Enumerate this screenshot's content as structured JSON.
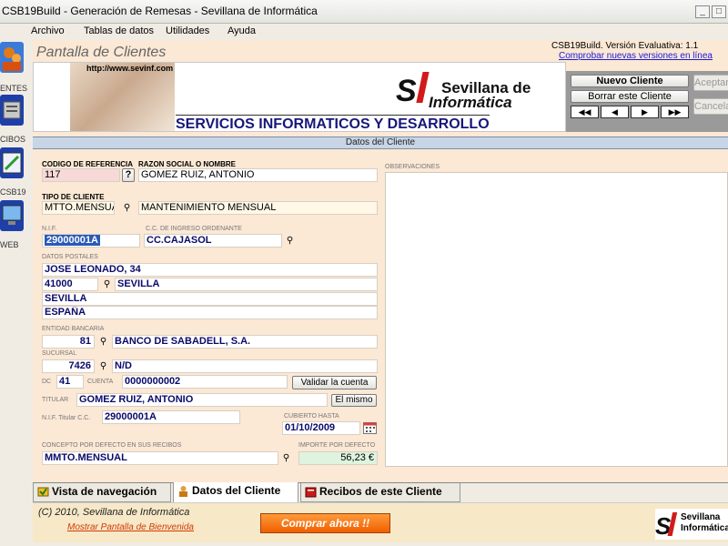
{
  "window": {
    "title": "CSB19Build - Generación de Remesas - Sevillana de Informática"
  },
  "menu": [
    "Archivo",
    "Tablas de datos",
    "Utilidades",
    "Ayuda"
  ],
  "left_toolbar": [
    {
      "label": "entes",
      "icon": "clients-icon"
    },
    {
      "label": "cibos",
      "icon": "receipts-icon"
    },
    {
      "label": "CSB19",
      "icon": "csb19-icon"
    },
    {
      "label": "Web",
      "icon": "web-icon"
    }
  ],
  "header": {
    "title": "Pantalla de Clientes",
    "version": "CSB19Build. Versión Evaluativa:  1.1",
    "check_updates": "Comprobar nuevas versiones en línea",
    "banner_url": "http://www.sevinf.com",
    "logo_line1": "Sevillana de",
    "logo_line2": "Informática",
    "services": "SERVICIOS INFORMATICOS Y DESARROLLO"
  },
  "buttons": {
    "new_client": "Nuevo Cliente",
    "delete_client": "Borrar este Cliente",
    "accept": "Aceptar",
    "cancel": "Cancelar",
    "nav_first": "◀◀",
    "nav_prev": "◀",
    "nav_next": "▶",
    "nav_last": "▶▶",
    "help": "?",
    "validate_account": "Validar la cuenta",
    "same": "El mismo"
  },
  "section_caption": "Datos del Cliente",
  "form": {
    "ref_label": "CODIGO DE REFERENCIA",
    "name_label": "RAZON SOCIAL O NOMBRE",
    "ref": "117",
    "name": "GOMEZ RUIZ, ANTONIO",
    "type_label": "TIPO DE CLIENTE",
    "type_code": "MTTO.MENSUAL",
    "type_desc": "MANTENIMIENTO MENSUAL",
    "nif_label": "N.I.F.",
    "nif": "29000001A",
    "cc_label": "C.C. DE INGRESO ORDENANTE",
    "cc": "CC.CAJASOL",
    "postal_label": "DATOS POSTALES",
    "address": "JOSE LEONADO, 34",
    "zip": "41000",
    "city": "SEVILLA",
    "province": "SEVILLA",
    "country": "ESPAÑA",
    "bank_label": "ENTIDAD BANCARIA",
    "bank_code": "81",
    "bank_name": "BANCO DE SABADELL, S.A.",
    "branch_label": "SUCURSAL",
    "branch_code": "7426",
    "branch_name": "N/D",
    "dc_label": "DC",
    "dc": "41",
    "account_label": "CUENTA",
    "account": "0000000002",
    "holder_label": "TITULAR",
    "holder": "GOMEZ RUIZ, ANTONIO",
    "holder_nif_label": "N.I.F. Titular C.C.",
    "holder_nif": "29000001A",
    "covered_label": "CUBIERTO HASTA",
    "covered_until": "01/10/2009",
    "concept_label": "CONCEPTO POR DEFECTO EN SUS RECIBOS",
    "concept": "MMTO.MENSUAL",
    "amount_label": "IMPORTE POR DEFECTO",
    "amount": "56,23 €",
    "obs_label": "OBSERVACIONES"
  },
  "tabs": [
    "Vista de navegación",
    "Datos del Cliente",
    "Recibos de este Cliente"
  ],
  "footer": {
    "copyright": "(C) 2010, Sevillana de Informática",
    "show_welcome": "Mostrar Pantalla de Bienvenida",
    "buy_now": "Comprar ahora !!",
    "logo_text": "Sevillana Informática"
  },
  "colors": {
    "panel": "#fbe8d5",
    "caption": "#c7d5e6",
    "buy": "#f07a10",
    "link": "#1a1ad8"
  }
}
